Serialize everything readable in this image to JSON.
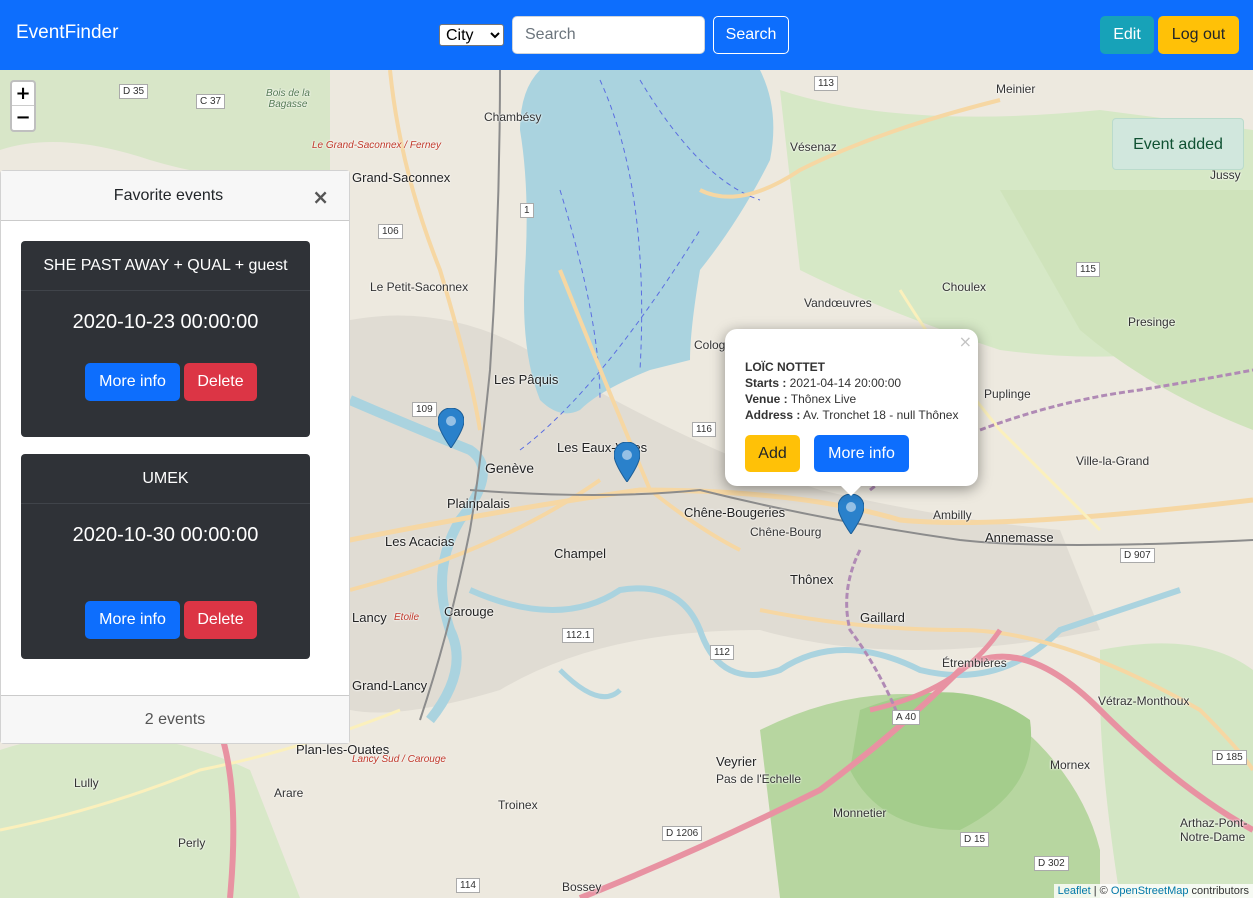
{
  "navbar": {
    "brand": "EventFinder",
    "city_select": {
      "selected": "City",
      "options": [
        "City"
      ]
    },
    "search": {
      "placeholder": "Search",
      "value": ""
    },
    "search_button": "Search",
    "edit_button": "Edit",
    "logout_button": "Log out",
    "colors": {
      "bar": "#0d6efd",
      "edit": "#17a2b8",
      "logout": "#ffc107"
    }
  },
  "map": {
    "zoom_in": "+",
    "zoom_out": "−",
    "toast": "Event added",
    "places": [
      "Meinier",
      "Chambésy",
      "Grand-Saconnex",
      "Le Grand-Saconnex / Ferney",
      "Vésenaz",
      "Jussy",
      "Le Petit-Saconnex",
      "Vandœuvres",
      "Choulex",
      "Presinge",
      "Cologny",
      "Les Pâquis",
      "Les Eaux-Vives",
      "Genève",
      "Plainpalais",
      "Les Acacias",
      "Champel",
      "Chêne-Bougeries",
      "Chêne-Bourg",
      "Thônex",
      "Ambilly",
      "Annemasse",
      "Puplinge",
      "Ville-la-Grand",
      "Carouge",
      "Lancy",
      "Grand-Lancy",
      "Gaillard",
      "Étrembières",
      "Vétraz-Monthoux",
      "Plan-les-Ouates",
      "Veyrier",
      "Pas de l'Echelle",
      "Troinex",
      "Arare",
      "Lully",
      "Perly",
      "Monnetier",
      "Mornex",
      "Bossey",
      "Arthaz-Pont-Notre-Dame",
      "Bois de la Bagasse",
      "Lancy Sud / Carouge",
      "Etoile"
    ],
    "road_shields": [
      "D 35",
      "C 37",
      "113",
      "106",
      "1",
      "115",
      "109",
      "116",
      "112.1",
      "112",
      "D 907",
      "A 40",
      "D 1206",
      "D 15",
      "D 302",
      "114",
      "D 185"
    ],
    "attribution": {
      "leaflet": "Leaflet",
      "sep": " | © ",
      "osm": "OpenStreetMap",
      "suffix": " contributors"
    }
  },
  "favorites_panel": {
    "title": "Favorite events",
    "close": "×",
    "events": [
      {
        "name": "SHE PAST AWAY + QUAL + guest",
        "date": "2020-10-23 00:00:00",
        "more_info": "More info",
        "delete": "Delete"
      },
      {
        "name": "UMEK",
        "date": "2020-10-30 00:00:00",
        "more_info": "More info",
        "delete": "Delete"
      }
    ],
    "footer": "2 events"
  },
  "popup": {
    "close": "×",
    "title": "LOÏC NOTTET",
    "starts_label": "Starts :",
    "starts_value": " 2021-04-14 20:00:00",
    "venue_label": "Venue :",
    "venue_value": " Thônex Live",
    "address_label": "Address :",
    "address_value": " Av. Tronchet 18 - null Thônex",
    "add_button": "Add",
    "more_info_button": "More info"
  }
}
